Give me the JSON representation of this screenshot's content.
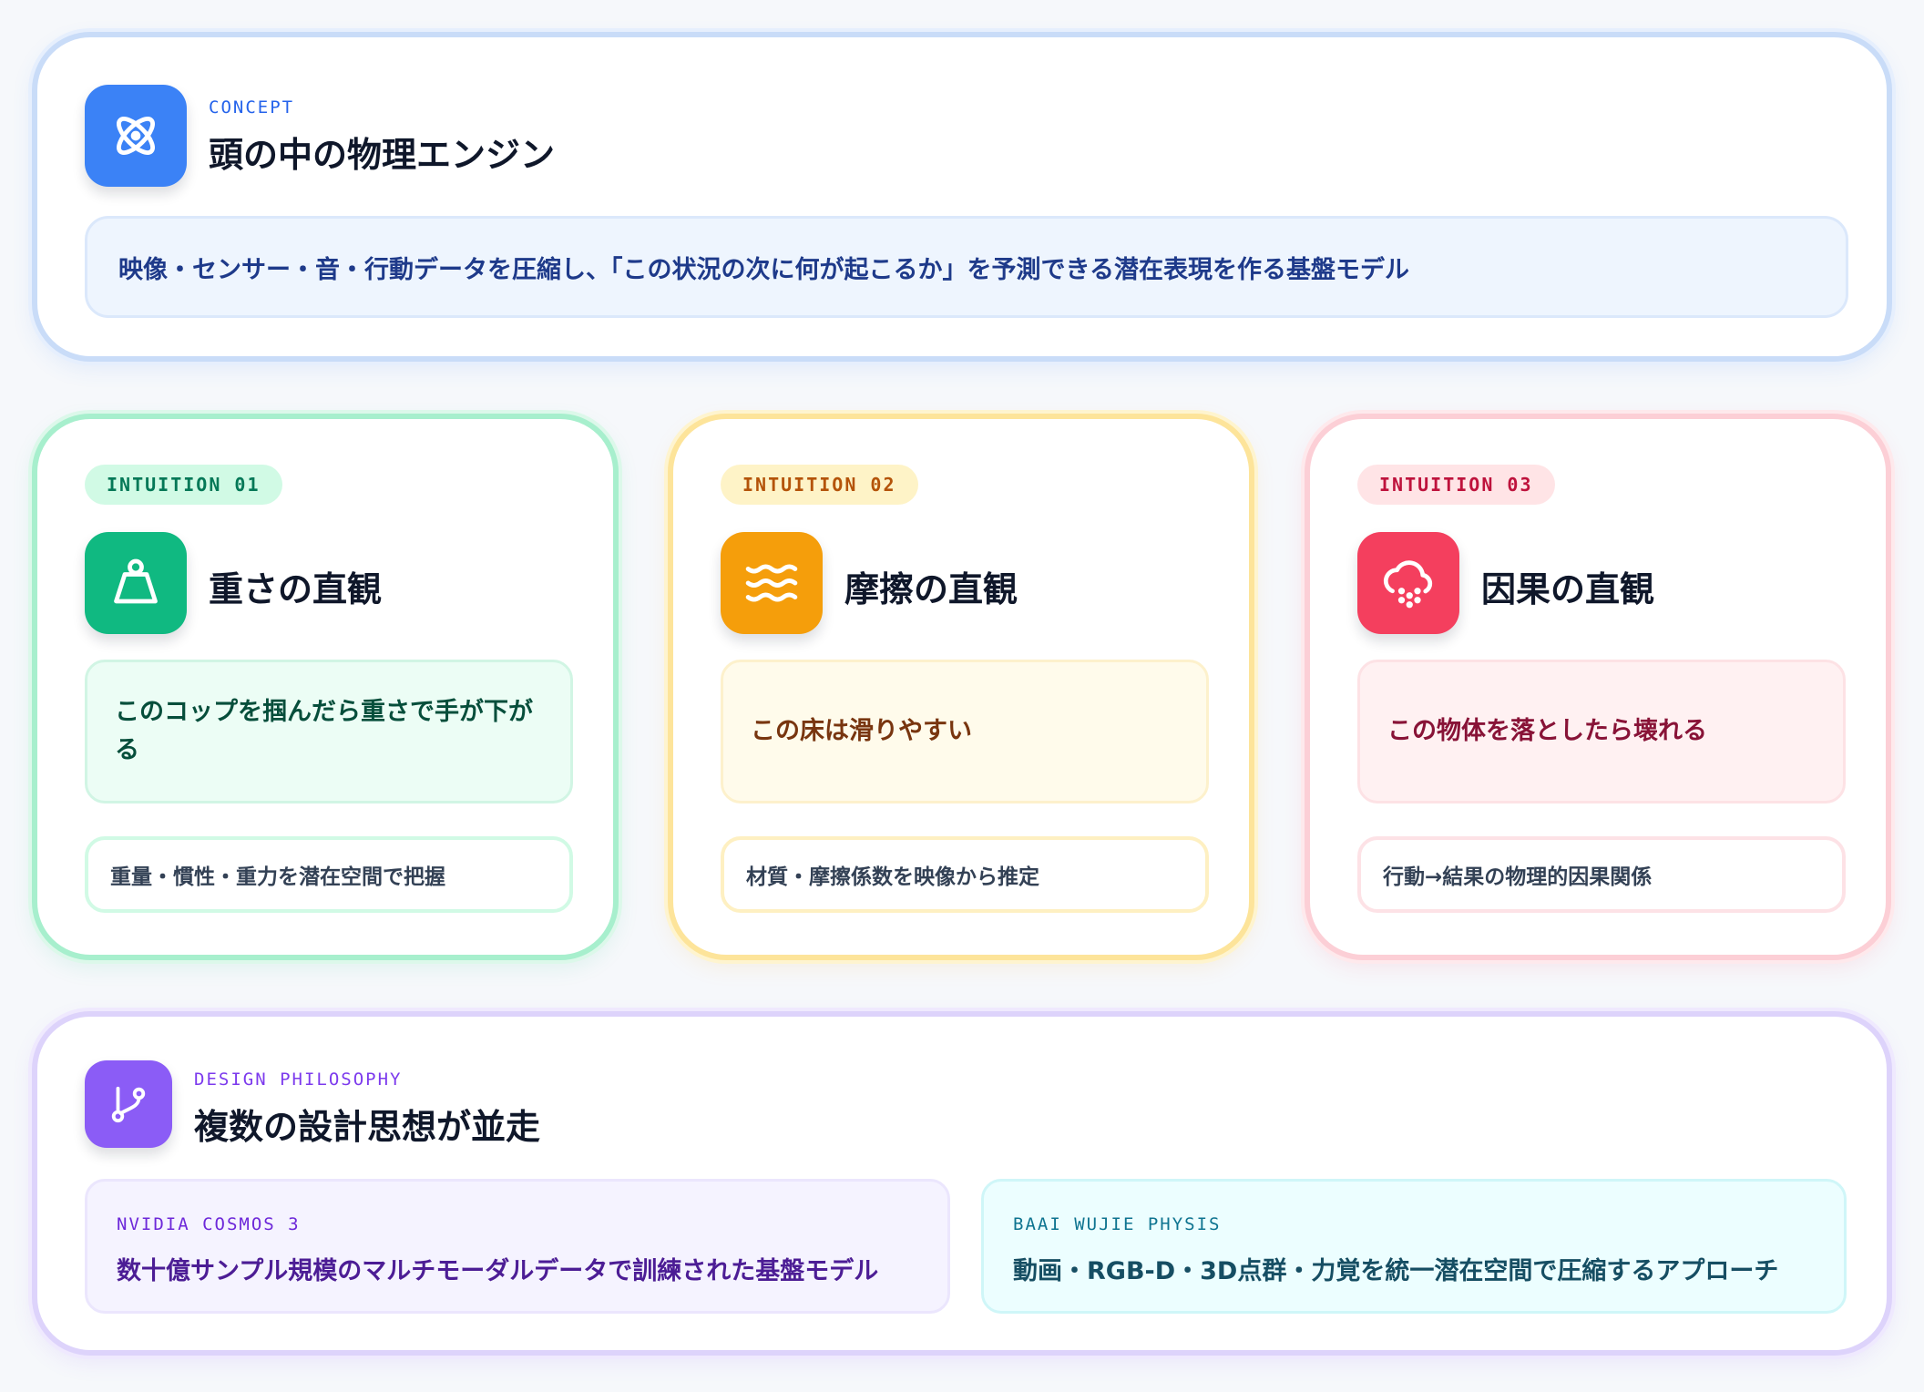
{
  "concept": {
    "kicker": "CONCEPT",
    "title": "頭の中の物理エンジン",
    "description": "映像・センサー・音・行動データを圧縮し、「この状況の次に何が起こるか」を予測できる潜在表現を作る基盤モデル",
    "icon": "atom-icon",
    "accent": "#3b82f6"
  },
  "intuitions": [
    {
      "tag": "INTUITION 01",
      "title": "重さの直観",
      "icon": "weight-icon",
      "example": "このコップを掴んだら重さで手が下がる",
      "note": "重量・慣性・重力を潜在空間で把握",
      "accent": "#10b981"
    },
    {
      "tag": "INTUITION 02",
      "title": "摩擦の直観",
      "icon": "waves-icon",
      "example": "この床は滑りやすい",
      "note": "材質・摩擦係数を映像から推定",
      "accent": "#f59e0b"
    },
    {
      "tag": "INTUITION 03",
      "title": "因果の直観",
      "icon": "cloud-hail-icon",
      "example": "この物体を落としたら壊れる",
      "note": "行動→結果の物理的因果関係",
      "accent": "#f43f5e"
    }
  ],
  "design": {
    "kicker": "DESIGN PHILOSOPHY",
    "title": "複数の設計思想が並走",
    "icon": "git-branch-icon",
    "accent": "#8b5cf6",
    "models": [
      {
        "name": "NVIDIA COSMOS 3",
        "description": "数十億サンプル規模のマルチモーダルデータで訓練された基盤モデル"
      },
      {
        "name": "BAAI WUJIE PHYSIS",
        "description": "動画・RGB-D・3D点群・力覚を統一潜在空間で圧縮するアプローチ"
      }
    ]
  }
}
